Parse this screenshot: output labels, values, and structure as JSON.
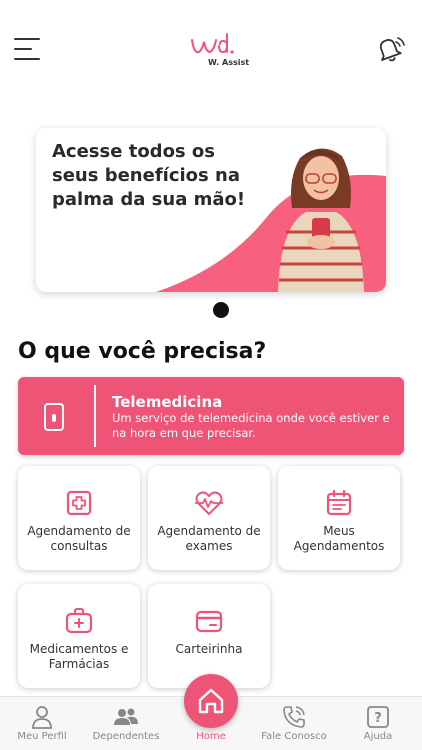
{
  "header": {
    "logo_text": "W. Assist",
    "menu_icon": "hamburger-menu-icon",
    "notification_icon": "bell-ringing-icon"
  },
  "banner": {
    "text": "Acesse todos os seus benefícios na palma da sua mão!"
  },
  "section_title": "O que você precisa?",
  "telemedicina": {
    "title": "Telemedicina",
    "description": "Um serviço de telemedicina onde você estiver e na hora em que precisar.",
    "icon": "smartphone-icon"
  },
  "services": [
    {
      "label": "Agendamento de consultas",
      "icon": "medical-cross-icon"
    },
    {
      "label": "Agendamento de exames",
      "icon": "heartbeat-icon"
    },
    {
      "label": "Meus Agendamentos",
      "icon": "calendar-icon"
    },
    {
      "label": "Medicamentos e Farmácias",
      "icon": "first-aid-kit-icon"
    },
    {
      "label": "Carteirinha",
      "icon": "card-icon"
    }
  ],
  "bottom_nav": {
    "items": [
      {
        "label": "Meu Perfil",
        "icon": "user-icon"
      },
      {
        "label": "Dependentes",
        "icon": "users-icon"
      },
      {
        "label": "Home",
        "icon": "home-icon",
        "active": true
      },
      {
        "label": "Fale Conosco",
        "icon": "phone-icon"
      },
      {
        "label": "Ajuda",
        "icon": "help-icon"
      }
    ]
  },
  "colors": {
    "accent": "#ee5476",
    "text": "#1a1a1a",
    "nav_inactive": "#888888"
  }
}
